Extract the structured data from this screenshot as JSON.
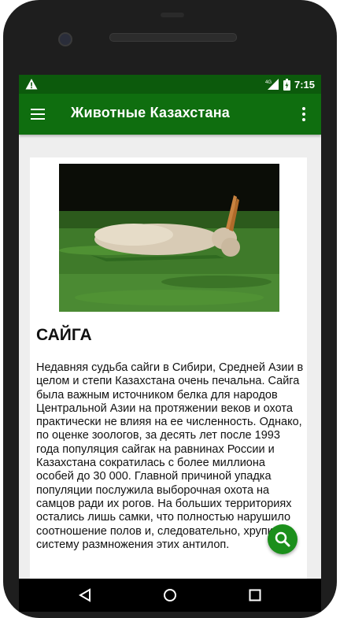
{
  "status_bar": {
    "warning_icon": "warning-icon",
    "signal_label": "4G",
    "time": "7:15"
  },
  "app_bar": {
    "menu_icon": "menu-icon",
    "title": "Животные Казахстана",
    "more_icon": "more-vert-icon",
    "color": "#0f6e0f"
  },
  "content": {
    "image_alt": "saiga-antelope-photo",
    "title": "САЙГА",
    "text": "Недавняя судьба сайги в Сибири, Средней Азии в целом и степи Казахстана очень печальна. Сайга была важным источником белка для народов Центральной Азии на протяжении веков и охота практически не влияя на ее численность. Однако, по оценке зоологов, за десять лет после 1993 года популяция сайгак на равнинах России и Казахстана сократилась с более миллиона особей до 30 000. Главной причиной упадка популяции послужила выборочная охота на самцов ради их рогов. На больших территориях остались лишь самки, что полностью нарушило соотношение полов и, следовательно, хрупкую систему размножения этих антилоп."
  },
  "fab": {
    "icon": "search-icon",
    "color": "#1b8f1b"
  },
  "nav_bar": {
    "back_icon": "back-triangle-icon",
    "home_icon": "home-circle-icon",
    "recents_icon": "recents-square-icon"
  }
}
